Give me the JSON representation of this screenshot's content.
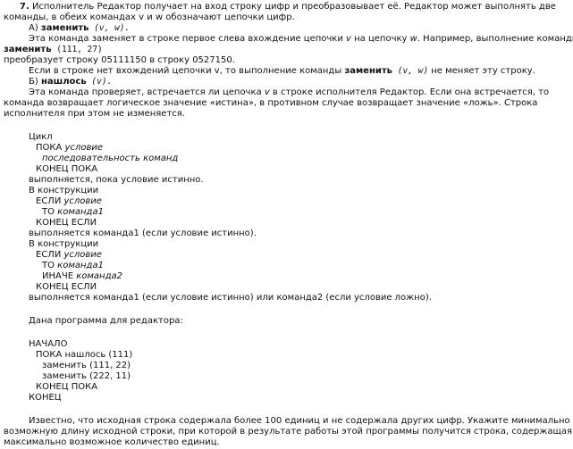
{
  "problem": {
    "number": "7.",
    "intro_1": " Исполнитель Редактор получает на вход строку цифр и преобразовывает её. Редактор может выполнять две",
    "intro_2": "команды, в обеих командах v и w обозначают цепочки цифр.",
    "a_prefix": "А) ",
    "a_cmd": "заменить",
    "a_args": " (v, w).",
    "a_desc_1a": "Эта команда заменяет в строке первое слева вхождение цепочки ",
    "a_desc_1v": "v",
    "a_desc_1b": " на цепочку ",
    "a_desc_1w": "w",
    "a_desc_1c": ". Например, выполнение команды",
    "a_example_cmd": "заменить",
    "a_example_args": " (111, 27)",
    "a_example_result": "преобразует строку 05111150 в строку 0527150.",
    "a_note_1": "Если в строке нет вхождений цепочки v, то выполнение команды ",
    "a_note_cmd": "заменить",
    "a_note_args": " (v, w)",
    "a_note_2": " не меняет эту строку.",
    "b_prefix": "Б) ",
    "b_cmd": "нашлось",
    "b_args": " (v).",
    "b_desc_1a": "Эта команда проверяет, встречается ли цепочка ",
    "b_desc_1v": "v",
    "b_desc_1b": " в строке исполнителя Редактор. Если она встречается, то",
    "b_desc_2": "команда возвращает логическое значение «истина», в противном случае возвращает значение «ложь». Строка",
    "b_desc_3": "исполнителя при этом не изменяется."
  },
  "constructs": {
    "c1_l1": "Цикл",
    "c1_l2a": "ПОКА ",
    "c1_l2b": "условие",
    "c1_l3": "последовательность команд",
    "c1_l4": "КОНЕЦ ПОКА",
    "c1_l5": "выполняется, пока условие истинно.",
    "c2_l1": "В конструкции",
    "c2_l2a": "ЕСЛИ ",
    "c2_l2b": "условие",
    "c2_l3a": "ТО ",
    "c2_l3b": "команда1",
    "c2_l4": "КОНЕЦ ЕСЛИ",
    "c2_l5": "выполняется команда1 (если условие истинно).",
    "c3_l1": "В конструкции",
    "c3_l2a": "ЕСЛИ ",
    "c3_l2b": "условие",
    "c3_l3a": "ТО ",
    "c3_l3b": "команда1",
    "c3_l4a": "ИНАЧЕ ",
    "c3_l4b": "команда2",
    "c3_l5": "КОНЕЦ ЕСЛИ",
    "c3_l6": "выполняется команда1 (если условие истинно) или команда2 (если условие ложно)."
  },
  "program": {
    "intro": "Дана программа для редактора:",
    "l1": "НАЧАЛО",
    "l2": "ПОКА нашлось (111)",
    "l3": "заменить (111, 22)",
    "l4": "заменить (222, 11)",
    "l5": "КОНЕЦ ПОКА",
    "l6": "КОНЕЦ"
  },
  "question": {
    "l1": "Известно, что исходная строка содержала более 100 единиц и не содержала других цифр. Укажите минимально",
    "l2": "возможную длину исходной строки, при которой в результате работы этой программы получится строка, содержащая",
    "l3": "максимально возможное количество единиц."
  }
}
